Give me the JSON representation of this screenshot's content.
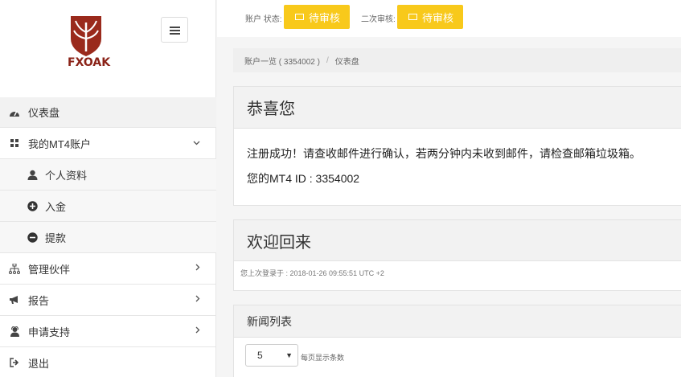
{
  "brand": {
    "name": "FXOAK",
    "color": "#8b2318"
  },
  "sidebar": {
    "items": [
      {
        "label": "仪表盘",
        "icon": "dashboard-icon"
      },
      {
        "label": "我的MT4账户",
        "icon": "grid-icon"
      },
      {
        "label": "个人资料",
        "icon": "user-icon"
      },
      {
        "label": "入金",
        "icon": "plus-circle-icon"
      },
      {
        "label": "提款",
        "icon": "minus-circle-icon"
      },
      {
        "label": "管理伙伴",
        "icon": "sitemap-icon"
      },
      {
        "label": "报告",
        "icon": "bullhorn-icon"
      },
      {
        "label": "申请支持",
        "icon": "support-icon"
      },
      {
        "label": "退出",
        "icon": "sign-out-icon"
      }
    ]
  },
  "status": {
    "account_label": "账户 状态:",
    "account_value": "待审核",
    "second_label": "二次审核:",
    "second_value": "待审核",
    "badge_color": "#f8c91b"
  },
  "breadcrumb": {
    "first": "账户一览 ( 3354002 )",
    "separator": "/",
    "current": "仪表盘"
  },
  "congrats": {
    "title": "恭喜您",
    "message": "注册成功！请查收邮件进行确认，若两分钟内未收到邮件，请检查邮箱垃圾箱。",
    "mt4_id": "您的MT4 ID : 3354002"
  },
  "welcome": {
    "title": "欢迎回来",
    "last_login": "您上次登录于 : 2018-01-26 09:55:51 UTC +2"
  },
  "news": {
    "title": "新闻列表",
    "page_size": "5",
    "page_size_label": "每页显示条数"
  }
}
